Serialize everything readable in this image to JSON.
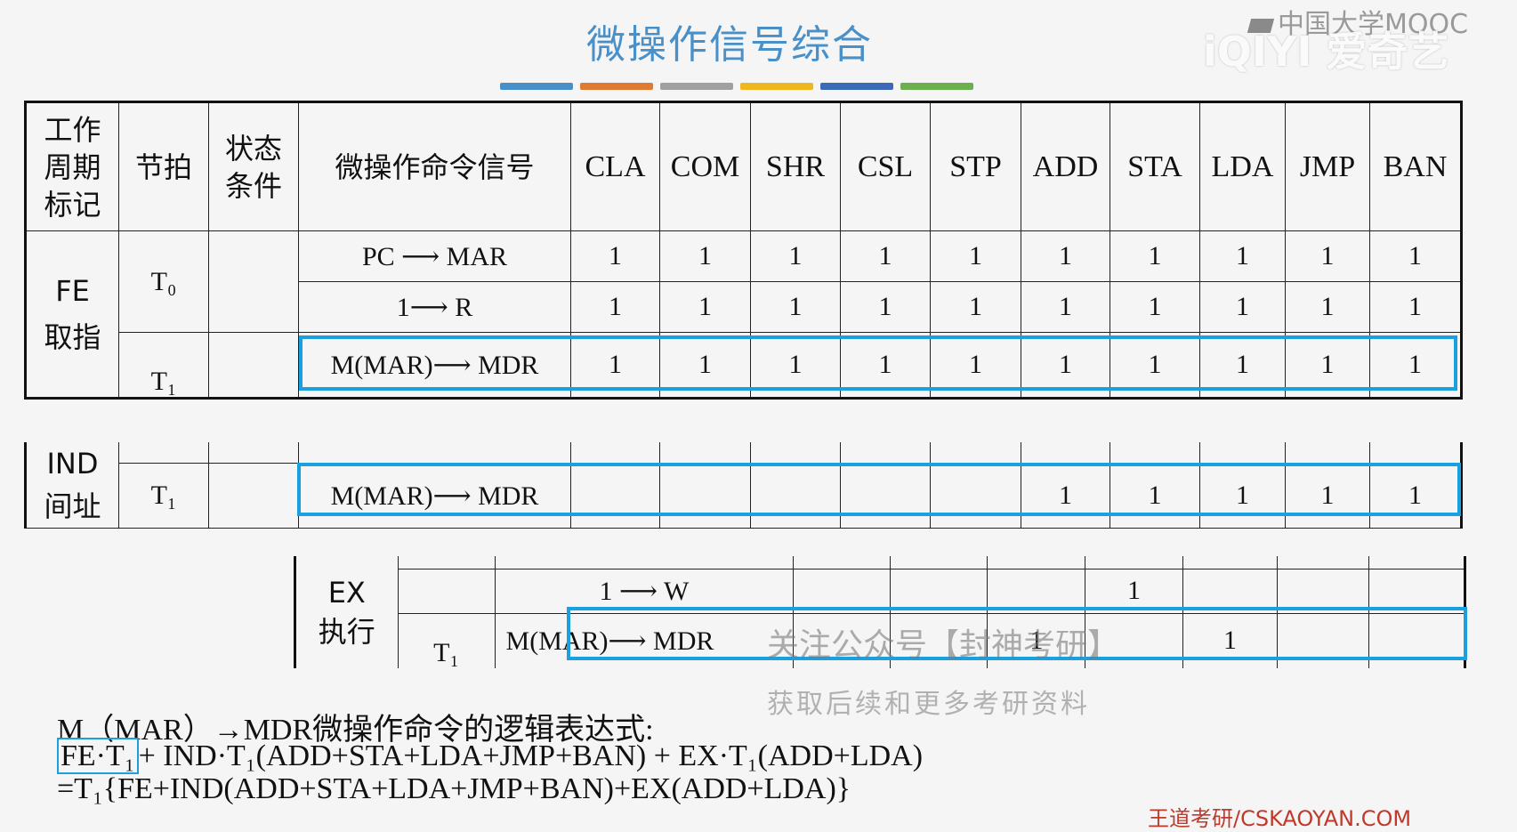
{
  "title": "微操作信号综合",
  "stripe_colors": [
    "#4a90c8",
    "#e07a30",
    "#a0a0a0",
    "#f0b820",
    "#3a6ab8",
    "#6ab04c"
  ],
  "logos": {
    "mooc": "中国大学MOOC",
    "iqiyi": "iQIYI 爱奇艺"
  },
  "table": {
    "headers": {
      "cycle": "工作\n周期\n标记",
      "beat": "节拍",
      "cond": "状态\n条件",
      "signal": "微操作命令信号",
      "instructions": [
        "CLA",
        "COM",
        "SHR",
        "CSL",
        "STP",
        "ADD",
        "STA",
        "LDA",
        "JMP",
        "BAN"
      ]
    },
    "fe": {
      "label": "FE\n取指",
      "t0": "T₀",
      "t1": "T₁",
      "rows": [
        {
          "signal": "PC ⟶ MAR",
          "values": [
            "1",
            "1",
            "1",
            "1",
            "1",
            "1",
            "1",
            "1",
            "1",
            "1"
          ]
        },
        {
          "signal": "1⟶ R",
          "values": [
            "1",
            "1",
            "1",
            "1",
            "1",
            "1",
            "1",
            "1",
            "1",
            "1"
          ]
        },
        {
          "signal": "M(MAR)⟶ MDR",
          "values": [
            "1",
            "1",
            "1",
            "1",
            "1",
            "1",
            "1",
            "1",
            "1",
            "1"
          ]
        }
      ]
    },
    "ind": {
      "label": "IND\n间址",
      "t1": "T₁",
      "row": {
        "signal": "M(MAR)⟶ MDR",
        "values": [
          "",
          "",
          "",
          "",
          "",
          "1",
          "1",
          "1",
          "1",
          "1"
        ]
      }
    },
    "ex": {
      "label": "EX\n执行",
      "t1": "T₁",
      "rows": [
        {
          "signal": "1 ⟶ W",
          "values": [
            "",
            "",
            "",
            "1",
            "",
            ""
          ]
        },
        {
          "signal": "M(MAR)⟶ MDR",
          "values": [
            "",
            "",
            "1",
            "",
            "1",
            ""
          ]
        }
      ]
    }
  },
  "watermarks": {
    "line1": "关注公众号【封神考研】",
    "line2": "获取后续和更多考研资料"
  },
  "formula": {
    "line1": "M（MAR）→MDR微操作命令的逻辑表达式:",
    "line2_box": "FE·T₁",
    "line2_rest": "+ IND·T₁(ADD+STA+LDA+JMP+BAN) + EX·T₁(ADD+LDA)",
    "line3": "=T₁{FE+IND(ADD+STA+LDA+JMP+BAN)+EX(ADD+LDA)}"
  },
  "footer": "王道考研/CSKAOYAN.COM"
}
